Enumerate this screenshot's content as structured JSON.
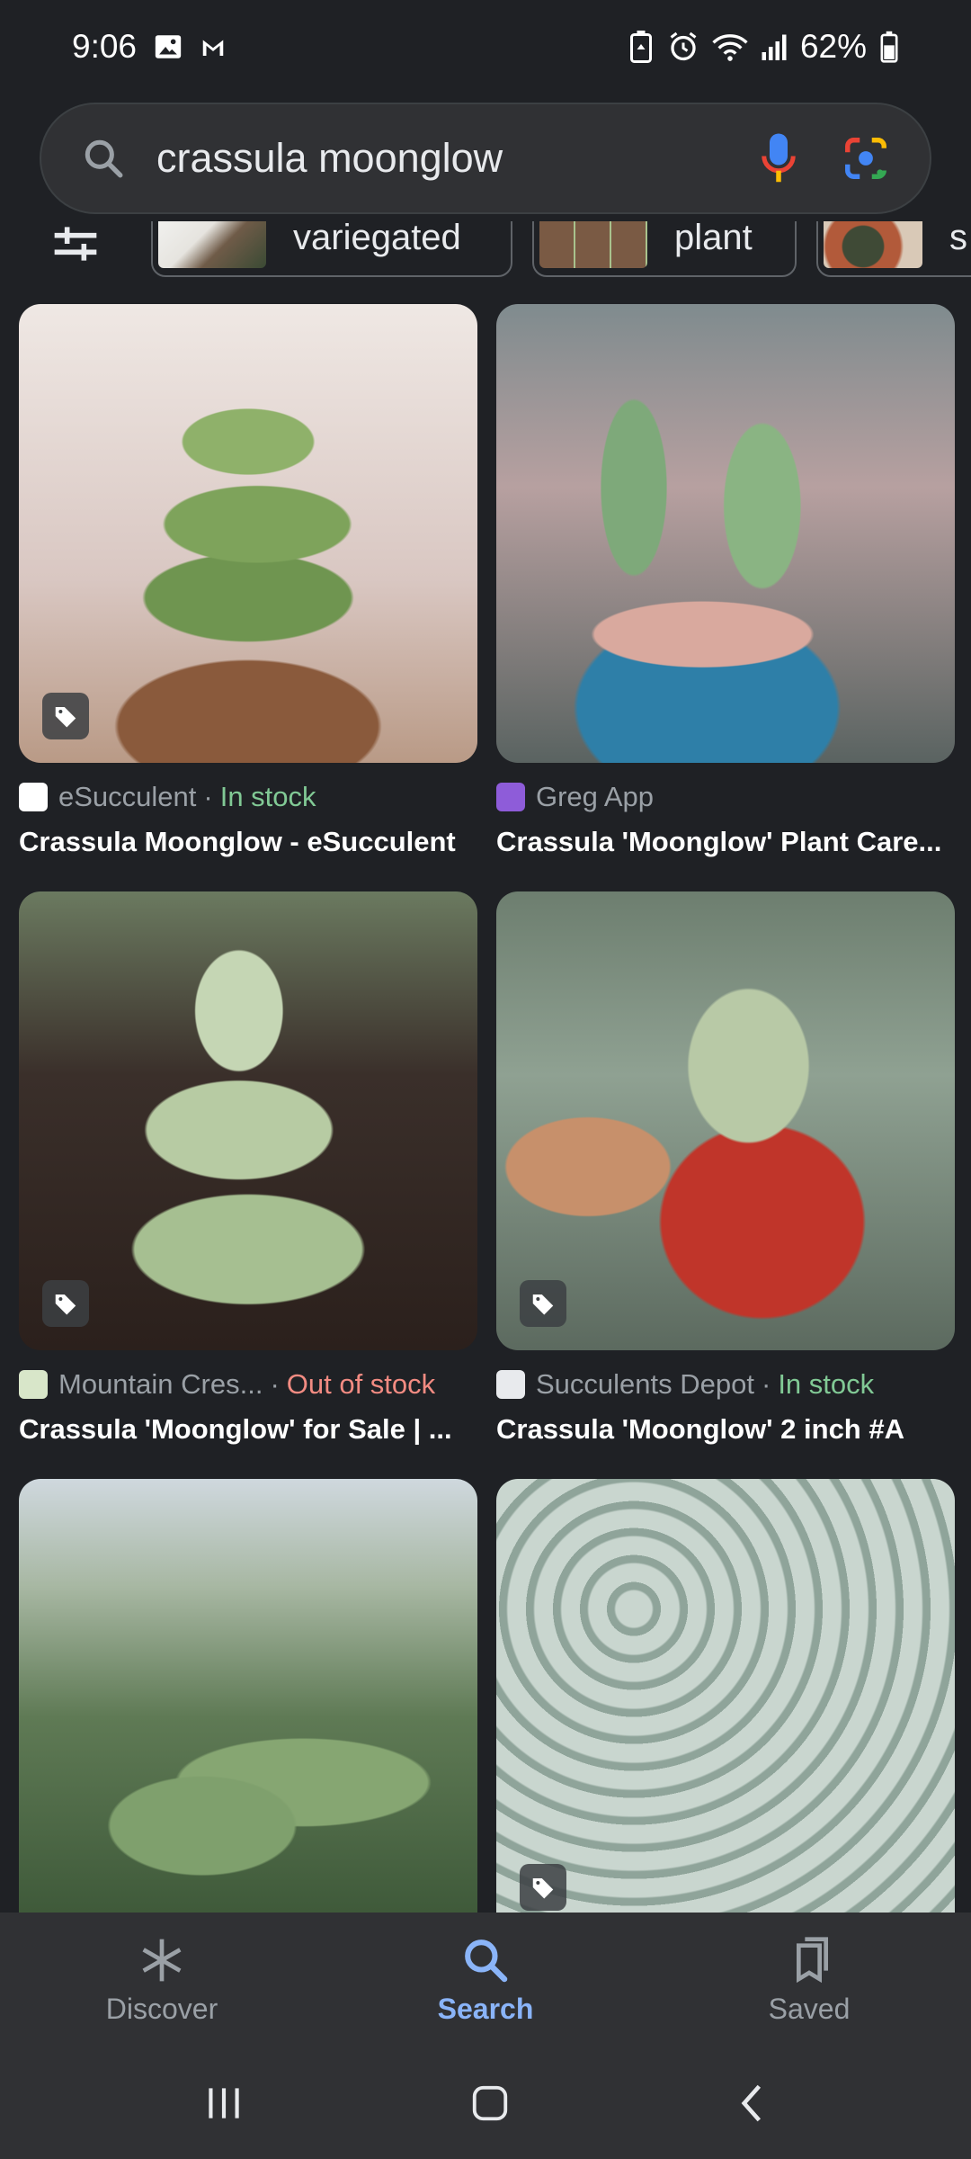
{
  "status": {
    "time": "9:06",
    "battery": "62%"
  },
  "search": {
    "query": "crassula moonglow"
  },
  "chips": [
    {
      "label": "variegated"
    },
    {
      "label": "plant"
    },
    {
      "label": "s"
    }
  ],
  "results": [
    {
      "source": "eSucculent",
      "stock": "In stock",
      "title": "Crassula Moonglow - eSucculent"
    },
    {
      "source": "Greg App",
      "stock": "",
      "title": "Crassula 'Moonglow' Plant Care..."
    },
    {
      "source": "Mountain Cres...",
      "stock": "Out of stock",
      "title": "Crassula 'Moonglow' for Sale | ..."
    },
    {
      "source": "Succulents Depot",
      "stock": "In stock",
      "title": "Crassula 'Moonglow' 2 inch #A"
    }
  ],
  "nav": {
    "discover": "Discover",
    "search": "Search",
    "saved": "Saved"
  },
  "colors": {
    "accent": "#8ab4f8",
    "in_stock": "#81c995",
    "out_of_stock": "#f28b82"
  }
}
